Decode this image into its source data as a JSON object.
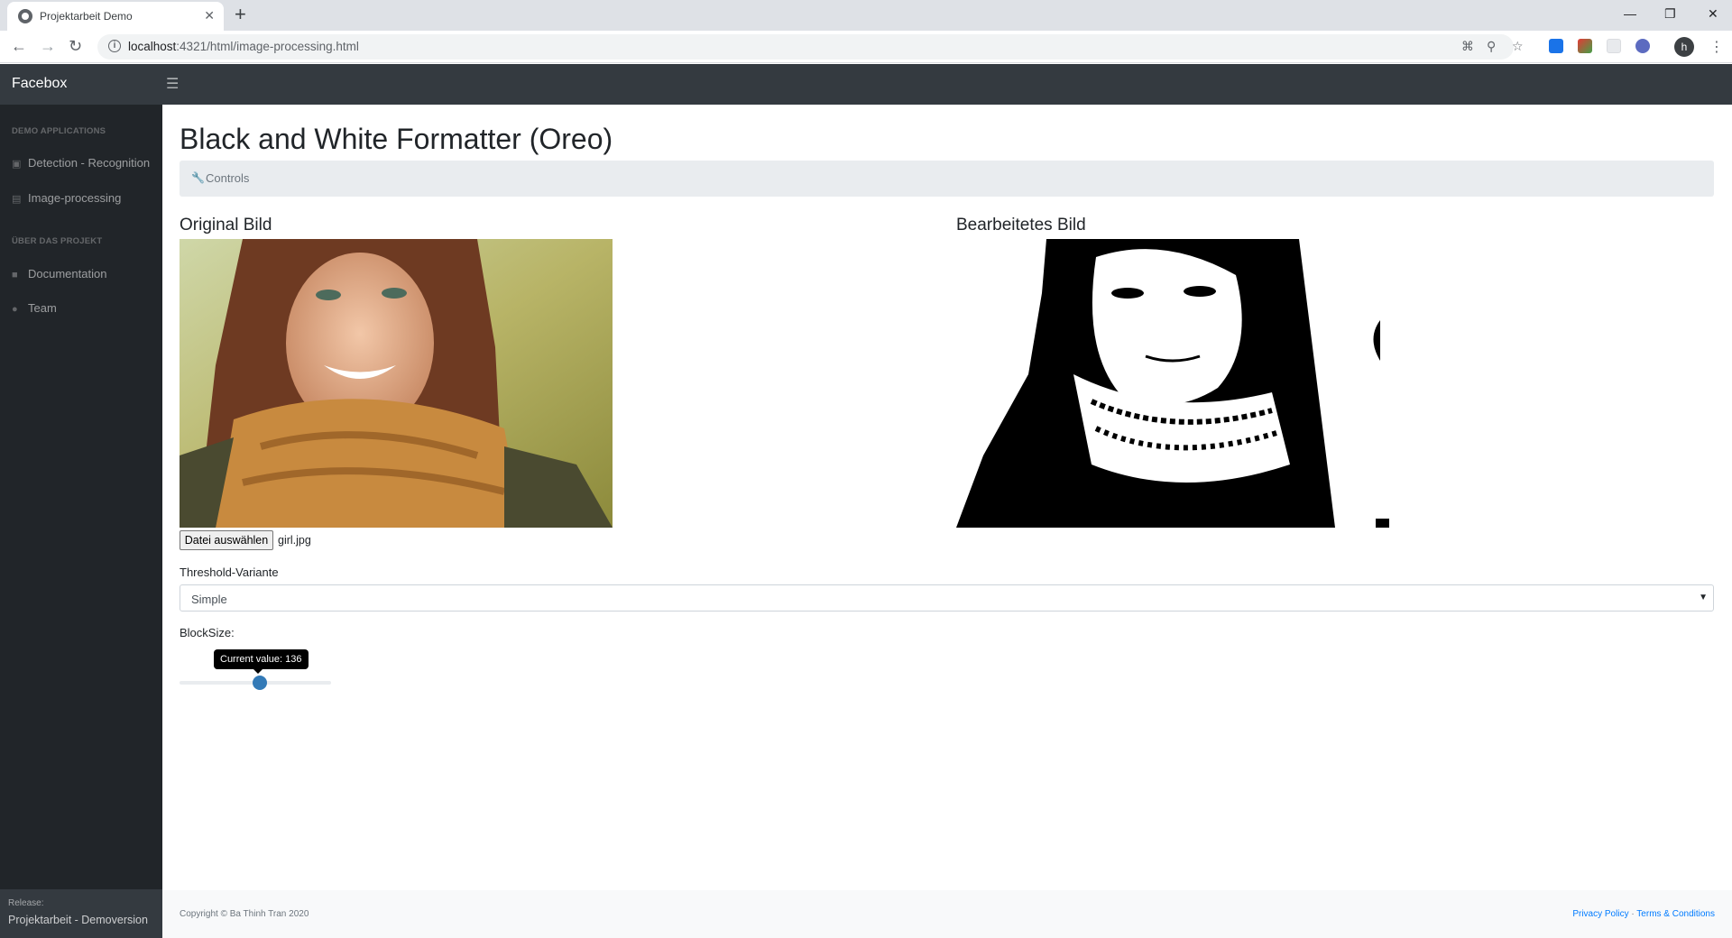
{
  "browser": {
    "tab_title": "Projektarbeit Demo",
    "url_host": "localhost",
    "url_rest": ":4321/html/image-processing.html"
  },
  "app": {
    "brand": "Facebox",
    "sidebar": {
      "sections": [
        {
          "heading": "Demo Applications",
          "items": [
            {
              "label": "Detection - Recognition",
              "icon": "camera-icon"
            },
            {
              "label": "Image-processing",
              "icon": "images-icon"
            }
          ]
        },
        {
          "heading": "Über das Projekt",
          "items": [
            {
              "label": "Documentation",
              "icon": "book-icon"
            },
            {
              "label": "Team",
              "icon": "users-icon"
            }
          ]
        }
      ],
      "footer_label": "Release:",
      "footer_value": "Projektarbeit - Demoversion"
    },
    "page_title": "Black and White Formatter (Oreo)",
    "breadcrumb": "Controls",
    "original_title": "Original Bild",
    "processed_title": "Bearbeitetes Bild",
    "file_button": "Datei auswählen",
    "file_name": "girl.jpg",
    "threshold_label": "Threshold-Variante",
    "threshold_value": "Simple",
    "blocksize_label": "BlockSize:",
    "slider_tooltip": "Current value: 136",
    "slider_fraction": 0.53,
    "copyright": "Copyright © Ba Thinh Tran 2020",
    "privacy": "Privacy Policy",
    "separator": " · ",
    "terms": "Terms & Conditions"
  },
  "colors": {
    "navbar": "#343a40",
    "sidebar": "#212529",
    "slider_handle": "#337ab7",
    "link": "#007bff"
  }
}
